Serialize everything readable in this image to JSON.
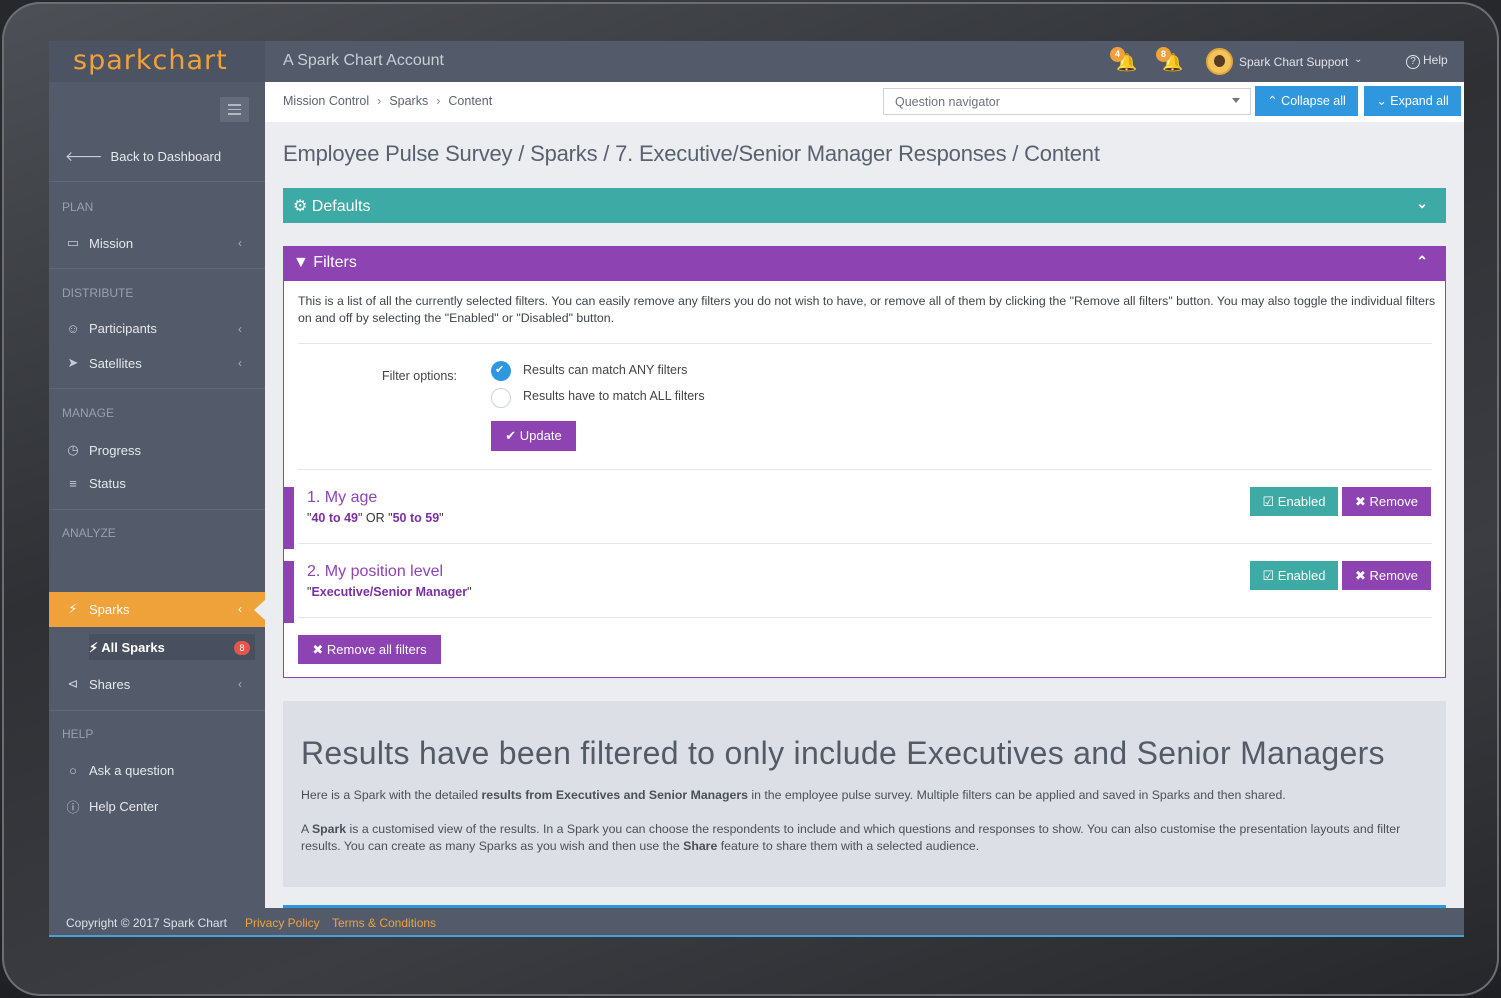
{
  "app": {
    "logo": "sparkchart",
    "account_title": "A Spark Chart Account"
  },
  "topbar": {
    "notifications": [
      {
        "icon": "bell-icon",
        "count": "4"
      },
      {
        "icon": "bell-icon",
        "count": "8"
      }
    ],
    "user_name": "Spark Chart Support",
    "help_label": "Help"
  },
  "sidebar": {
    "back_label": "Back to Dashboard",
    "sections": {
      "plan": "PLAN",
      "distribute": "DISTRIBUTE",
      "manage": "MANAGE",
      "analyze": "ANALYZE",
      "help": "HELP"
    },
    "items": {
      "mission": "Mission",
      "participants": "Participants",
      "satellites": "Satellites",
      "progress": "Progress",
      "status": "Status",
      "sparks": "Sparks",
      "all_sparks": "All Sparks",
      "all_sparks_badge": "8",
      "shares": "Shares",
      "ask_question": "Ask a question",
      "help_center": "Help Center"
    }
  },
  "breadcrumb": [
    "Mission Control",
    "Sparks",
    "Content"
  ],
  "question_navigator": {
    "placeholder": "Question navigator"
  },
  "toolbar": {
    "collapse_all": "Collapse all",
    "expand_all": "Expand all"
  },
  "page_title": "Employee Pulse Survey / Sparks / 7. Executive/Senior Manager Responses / Content",
  "defaults_panel": {
    "title": "Defaults"
  },
  "filters_panel": {
    "title": "Filters",
    "description": "This is a list of all the currently selected filters. You can easily remove any filters you do not wish to have, or remove all of them by clicking the \"Remove all filters\" button. You may also toggle the individual filters on and off by selecting the \"Enabled\" or \"Disabled\" button.",
    "filter_options_label": "Filter options:",
    "option_any": "Results can match ANY filters",
    "option_all": "Results have to match ALL filters",
    "update_label": "Update",
    "filters": [
      {
        "title": "1. My age",
        "value_1": "40 to 49",
        "joiner": "OR",
        "value_2": "50 to 59",
        "enabled_label": "Enabled",
        "remove_label": "Remove"
      },
      {
        "title": "2. My position level",
        "value_1": "Executive/Senior Manager",
        "enabled_label": "Enabled",
        "remove_label": "Remove"
      }
    ],
    "remove_all_label": "Remove all filters"
  },
  "results": {
    "title": "Results have been filtered to only include Executives and Senior Managers",
    "p1_pre": "Here is a Spark with the detailed ",
    "p1_bold": "results from Executives and Senior Managers",
    "p1_post": " in the employee pulse survey. Multiple filters can be applied and saved in Sparks and then shared.",
    "p2_pre": "A ",
    "p2_bold1": "Spark",
    "p2_mid": " is a customised view of the results. In a Spark you can choose the respondents to include and which questions and responses to show. You can also customise the presentation layouts and filter results. You can create as many Sparks as you wish and then use the ",
    "p2_bold2": "Share",
    "p2_post": " feature to share them with a selected audience."
  },
  "footer": {
    "copyright": "Copyright © 2017 Spark Chart",
    "privacy": "Privacy Policy",
    "terms": "Terms & Conditions"
  },
  "colors": {
    "accent_orange": "#f0a23a",
    "teal": "#3eaaa6",
    "purple": "#8e43b3",
    "blue": "#2e97dd",
    "sidebar": "#535b6a"
  }
}
